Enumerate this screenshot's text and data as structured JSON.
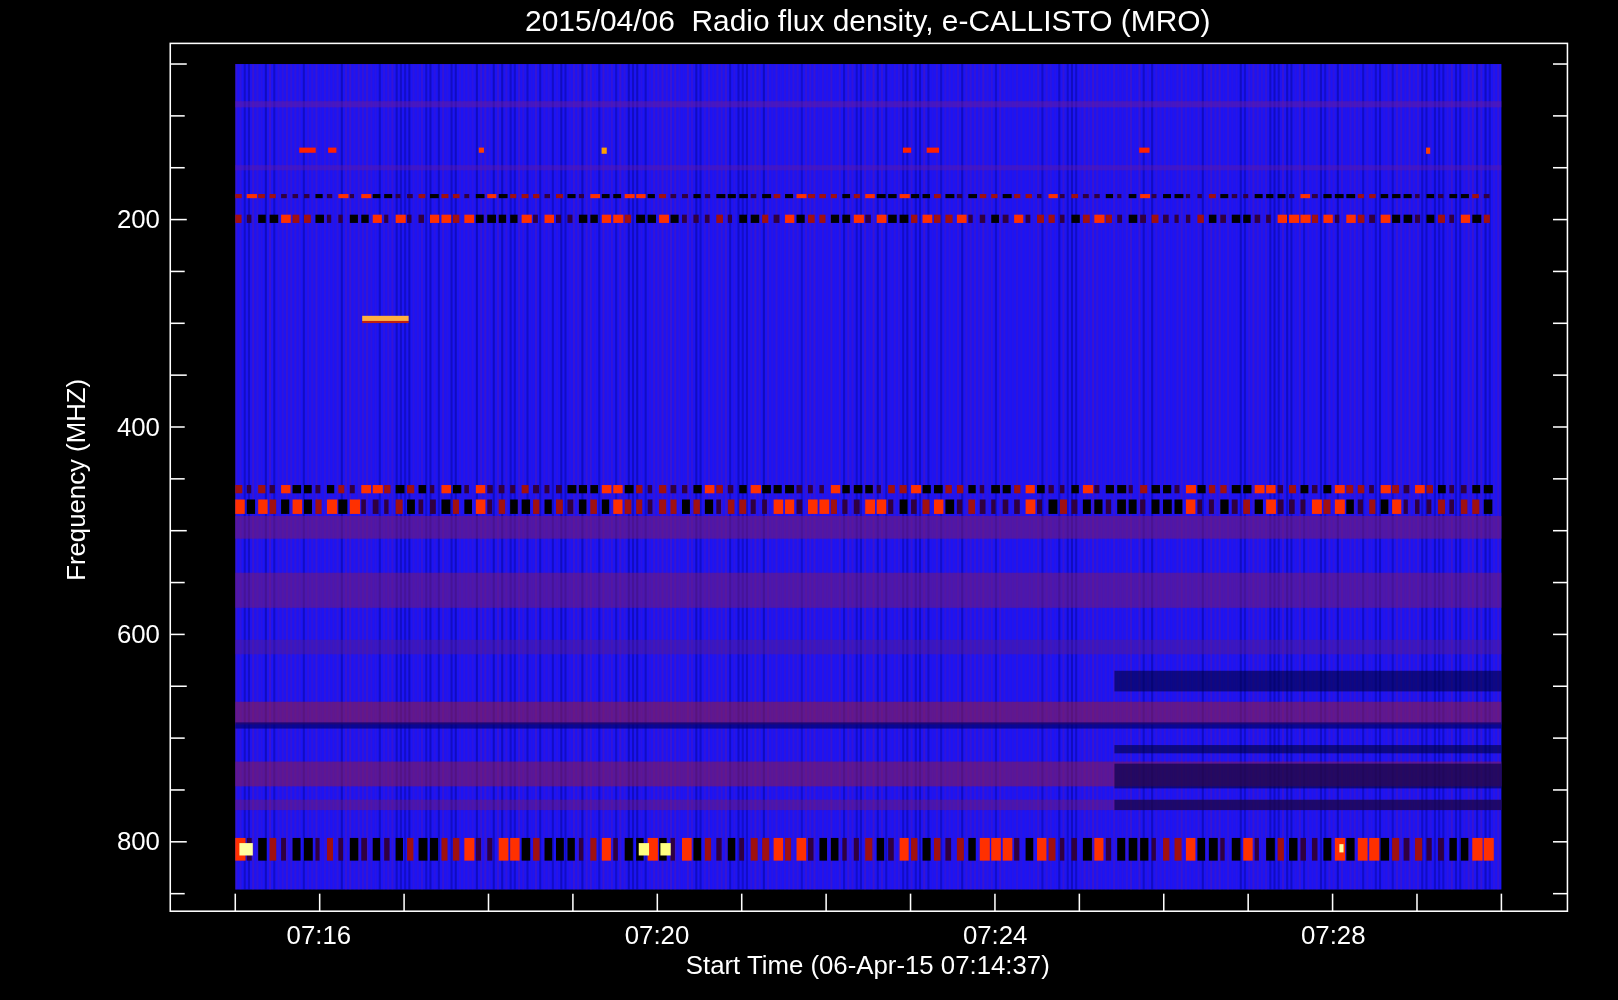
{
  "title": "2015/04/06  Radio flux density, e-CALLISTO (MRO)",
  "y_axis": {
    "label": "Frequency (MHZ)",
    "ticks": [
      "200",
      "400",
      "600",
      "800"
    ]
  },
  "x_axis": {
    "label": "Start Time (06-Apr-15 07:14:37)",
    "ticks": [
      "07:16",
      "07:20",
      "07:24",
      "07:28"
    ]
  }
}
